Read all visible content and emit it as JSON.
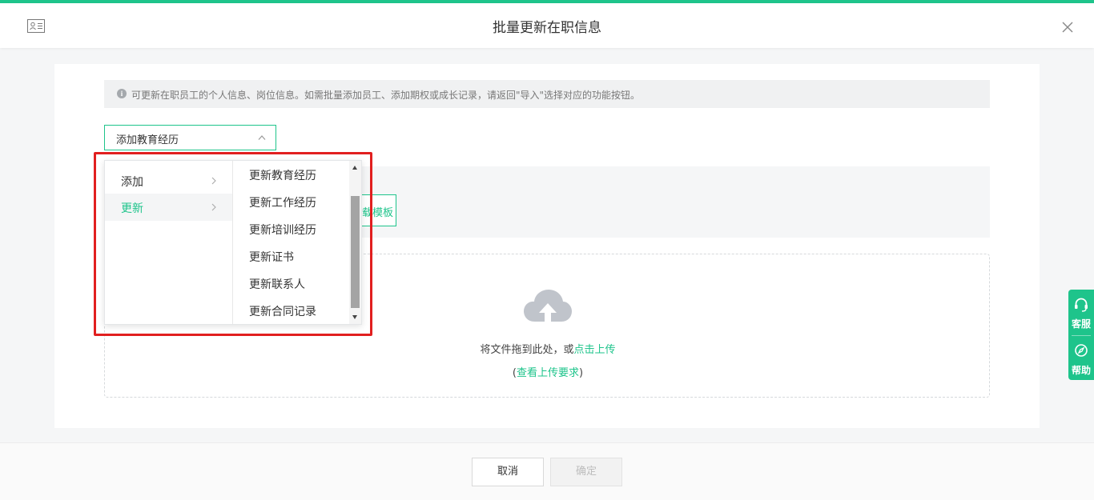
{
  "header": {
    "title": "批量更新在职信息",
    "close_icon": "close-icon",
    "app_icon": "id-card-icon"
  },
  "notice": {
    "text": "可更新在职员工的个人信息、岗位信息。如需批量添加员工、添加期权或成长记录，请返回\"导入\"选择对应的功能按钮。"
  },
  "select": {
    "value": "添加教育经历"
  },
  "template_button": {
    "label": "载模板"
  },
  "upload": {
    "text": "将文件拖到此处，或",
    "link": "点击上传",
    "req_prefix": "(",
    "req_link": "查看上传要求",
    "req_suffix": ")"
  },
  "cascader": {
    "level1": [
      {
        "label": "添加",
        "active": false
      },
      {
        "label": "更新",
        "active": true
      }
    ],
    "level2": [
      "更新教育经历",
      "更新工作经历",
      "更新培训经历",
      "更新证书",
      "更新联系人",
      "更新合同记录"
    ]
  },
  "side_tools": [
    {
      "label": "客服",
      "icon": "headset-icon"
    },
    {
      "label": "帮助",
      "icon": "compass-icon"
    }
  ],
  "footer": {
    "cancel": "取消",
    "confirm": "确定"
  },
  "colors": {
    "accent": "#1ec48b",
    "highlight": "#e11f1f"
  }
}
